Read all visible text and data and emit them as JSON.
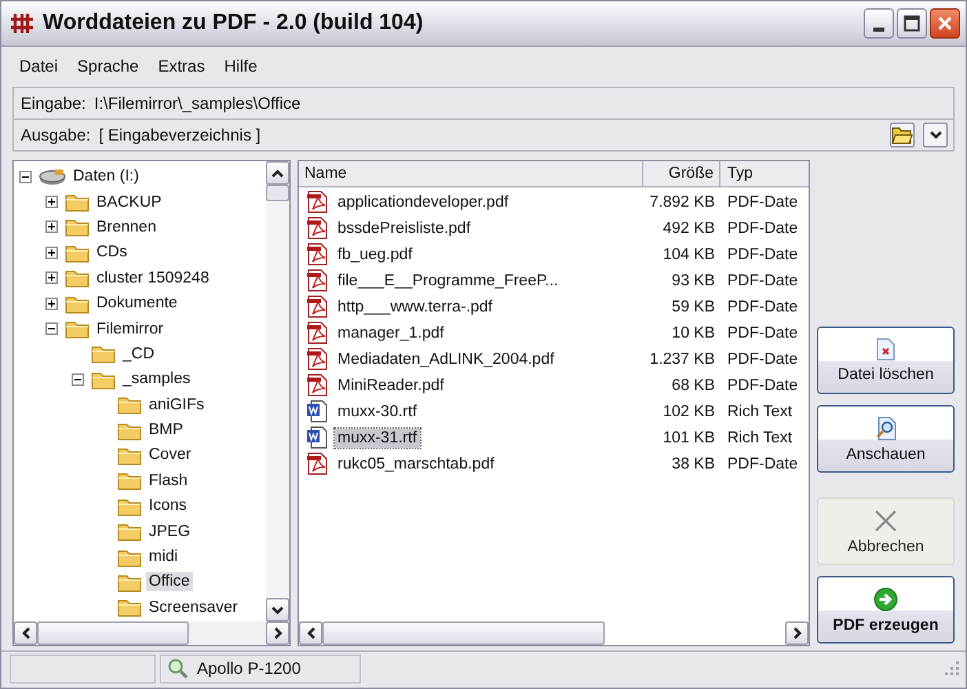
{
  "window": {
    "title": "Worddateien zu PDF - 2.0 (build 104)"
  },
  "menu": [
    "Datei",
    "Sprache",
    "Extras",
    "Hilfe"
  ],
  "paths": [
    {
      "label": "Eingabe:",
      "value": "I:\\Filemirror\\_samples\\Office",
      "kind": "plain"
    },
    {
      "label": "Ausgabe:",
      "value": "[ Eingabeverzeichnis ]",
      "kind": "chooser"
    }
  ],
  "tree": [
    {
      "label": "Daten (I:)",
      "kind": "drive",
      "expandable": true,
      "expanded": true,
      "selected": false,
      "children": [
        {
          "label": "BACKUP",
          "kind": "folder",
          "expandable": true,
          "expanded": false,
          "selected": false
        },
        {
          "label": "Brennen",
          "kind": "folder",
          "expandable": true,
          "expanded": false,
          "selected": false
        },
        {
          "label": "CDs",
          "kind": "folder",
          "expandable": true,
          "expanded": false,
          "selected": false
        },
        {
          "label": "cluster 1509248",
          "kind": "folder",
          "expandable": true,
          "expanded": false,
          "selected": false
        },
        {
          "label": "Dokumente",
          "kind": "folder",
          "expandable": true,
          "expanded": false,
          "selected": false
        },
        {
          "label": "Filemirror",
          "kind": "folder",
          "expandable": true,
          "expanded": true,
          "selected": false,
          "children": [
            {
              "label": "_CD",
              "kind": "folder",
              "expandable": false,
              "selected": false
            },
            {
              "label": "_samples",
              "kind": "folder",
              "expandable": true,
              "expanded": true,
              "selected": false,
              "children": [
                {
                  "label": "aniGIFs",
                  "kind": "folder",
                  "expandable": false,
                  "selected": false
                },
                {
                  "label": "BMP",
                  "kind": "folder",
                  "expandable": false,
                  "selected": false
                },
                {
                  "label": "Cover",
                  "kind": "folder",
                  "expandable": false,
                  "selected": false
                },
                {
                  "label": "Flash",
                  "kind": "folder",
                  "expandable": false,
                  "selected": false
                },
                {
                  "label": "Icons",
                  "kind": "folder",
                  "expandable": false,
                  "selected": false
                },
                {
                  "label": "JPEG",
                  "kind": "folder",
                  "expandable": false,
                  "selected": false
                },
                {
                  "label": "midi",
                  "kind": "folder",
                  "expandable": false,
                  "selected": false
                },
                {
                  "label": "Office",
                  "kind": "folder",
                  "expandable": false,
                  "selected": true
                },
                {
                  "label": "Screensaver",
                  "kind": "folder",
                  "expandable": false,
                  "selected": false
                }
              ]
            }
          ]
        }
      ]
    }
  ],
  "files": {
    "columns": [
      "Name",
      "Größe",
      "Typ"
    ],
    "rows": [
      {
        "name": "applicationdeveloper.pdf",
        "size": "7.892 KB",
        "type": "PDF-Date",
        "kind": "pdf",
        "selected": false
      },
      {
        "name": "bssdePreisliste.pdf",
        "size": "492 KB",
        "type": "PDF-Date",
        "kind": "pdf",
        "selected": false
      },
      {
        "name": "fb_ueg.pdf",
        "size": "104 KB",
        "type": "PDF-Date",
        "kind": "pdf",
        "selected": false
      },
      {
        "name": "file___E__Programme_FreeP...",
        "size": "93 KB",
        "type": "PDF-Date",
        "kind": "pdf",
        "selected": false
      },
      {
        "name": "http___www.terra-.pdf",
        "size": "59 KB",
        "type": "PDF-Date",
        "kind": "pdf",
        "selected": false
      },
      {
        "name": "manager_1.pdf",
        "size": "10 KB",
        "type": "PDF-Date",
        "kind": "pdf",
        "selected": false
      },
      {
        "name": "Mediadaten_AdLINK_2004.pdf",
        "size": "1.237 KB",
        "type": "PDF-Date",
        "kind": "pdf",
        "selected": false
      },
      {
        "name": "MiniReader.pdf",
        "size": "68 KB",
        "type": "PDF-Date",
        "kind": "pdf",
        "selected": false
      },
      {
        "name": "muxx-30.rtf",
        "size": "102 KB",
        "type": "Rich Text",
        "kind": "rtf",
        "selected": false
      },
      {
        "name": "muxx-31.rtf",
        "size": "101 KB",
        "type": "Rich Text",
        "kind": "rtf",
        "selected": true
      },
      {
        "name": "rukc05_marschtab.pdf",
        "size": "38 KB",
        "type": "PDF-Date",
        "kind": "pdf",
        "selected": false
      }
    ]
  },
  "actions": [
    {
      "label": "Datei löschen",
      "kind": "delete",
      "disabled": false
    },
    {
      "label": "Anschauen",
      "kind": "view",
      "disabled": false
    },
    {
      "label": "Abbrechen",
      "kind": "cancel",
      "disabled": true
    },
    {
      "label": "PDF erzeugen",
      "kind": "create",
      "disabled": false
    }
  ],
  "status_bar": {
    "printer": "Apollo P-1200"
  }
}
